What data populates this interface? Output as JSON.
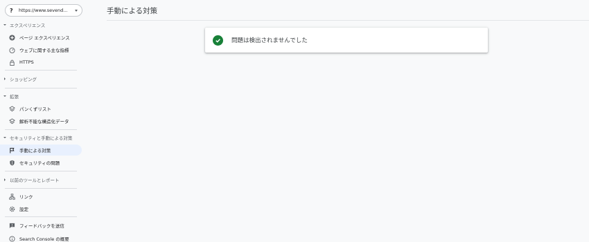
{
  "property": {
    "url": "https://www.sevend...",
    "icon": "question-icon"
  },
  "sections": [
    {
      "label": "エクスペリエンス",
      "expanded": true
    },
    {
      "label": "ショッピング",
      "expanded": false
    },
    {
      "label": "拡張",
      "expanded": true
    },
    {
      "label": "セキュリティと手動による対策",
      "expanded": true
    },
    {
      "label": "以前のツールとレポート",
      "expanded": false
    }
  ],
  "nav": {
    "page_experience": "ページ エクスペリエンス",
    "core_web_vitals": "ウェブに関する主な指標",
    "https": "HTTPS",
    "breadcrumbs": "パンくずリスト",
    "unparsable": "解析不能な構造化データ",
    "manual_actions": "手動による対策",
    "security_issues": "セキュリティの問題",
    "links": "リンク",
    "settings": "設定",
    "feedback": "フィードバックを送信",
    "about": "Search Console の概要"
  },
  "main": {
    "title": "手動による対策",
    "status_message": "問題は検出されませんでした"
  },
  "colors": {
    "active_bg": "#e8f0fe",
    "success": "#188038"
  }
}
